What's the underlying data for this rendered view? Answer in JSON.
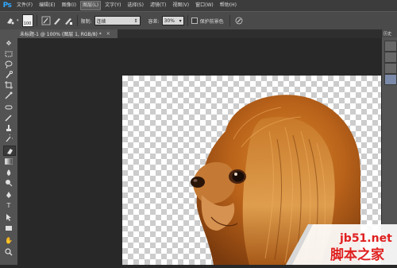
{
  "app": {
    "logo": "Ps"
  },
  "menu": [
    {
      "label": "文件(F)",
      "active": false
    },
    {
      "label": "编辑(E)",
      "active": false
    },
    {
      "label": "图像(I)",
      "active": false
    },
    {
      "label": "图层(L)",
      "active": true
    },
    {
      "label": "文字(Y)",
      "active": false
    },
    {
      "label": "选择(S)",
      "active": false
    },
    {
      "label": "滤镜(T)",
      "active": false
    },
    {
      "label": "视图(V)",
      "active": false
    },
    {
      "label": "窗口(W)",
      "active": false
    },
    {
      "label": "帮助(H)",
      "active": false
    }
  ],
  "options": {
    "brush_size": "100",
    "limit_label": "限制:",
    "limit_value": "连续",
    "tolerance_label": "容差:",
    "tolerance_value": "30%",
    "protect_label": "保护前景色"
  },
  "document": {
    "tab_title": "未标题-1 @ 100% (图层 1, RGB/8) *",
    "close_glyph": "×"
  },
  "panel": {
    "tab_label": "历史"
  },
  "watermark": {
    "site": "jb51.net",
    "name": "脚本之家"
  },
  "icons": {
    "tools": [
      "move-icon",
      "marquee-icon",
      "lasso-icon",
      "quick-selection-icon",
      "crop-icon",
      "eyedropper-icon",
      "healing-brush-icon",
      "brush-icon",
      "clone-stamp-icon",
      "history-brush-icon",
      "background-eraser-icon",
      "gradient-icon",
      "blur-icon",
      "dodge-icon",
      "pen-icon",
      "type-icon",
      "path-selection-icon",
      "rectangle-icon",
      "hand-icon",
      "zoom-icon"
    ]
  },
  "colors": {
    "menubar": "#3c3c3c",
    "optionsbar": "#4a4a4a",
    "toolbox": "#535353",
    "workspace": "#282828",
    "ps_blue": "#31a8ff",
    "watermark_red": "#e02020"
  }
}
